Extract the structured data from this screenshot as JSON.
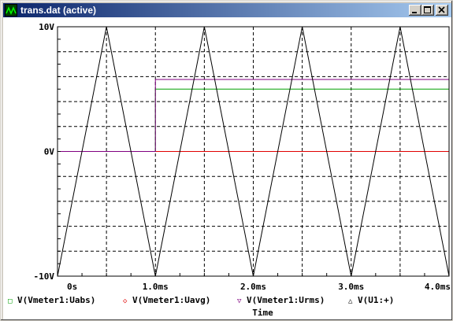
{
  "window": {
    "title": "trans.dat (active)",
    "controls": [
      "minimize",
      "maximize",
      "close"
    ]
  },
  "plot": {
    "background": "#ffffff",
    "grid_color": "#000000",
    "y_tick_labels": [
      "10V",
      "0V",
      "-10V"
    ],
    "x_tick_labels": [
      "0s",
      "1.0ms",
      "2.0ms",
      "3.0ms",
      "4.0ms"
    ],
    "xlabel": "Time",
    "legend": [
      {
        "symbol": "□",
        "label": "V(Vmeter1:Uabs)",
        "color": "#00a000"
      },
      {
        "symbol": "◇",
        "label": "V(Vmeter1:Uavg)",
        "color": "#e00000"
      },
      {
        "symbol": "▽",
        "label": "V(Vmeter1:Urms)",
        "color": "#800080"
      },
      {
        "symbol": "△",
        "label": "V(U1:+)",
        "color": "#000000"
      }
    ]
  },
  "chart_data": {
    "type": "line",
    "x_unit": "ms",
    "y_unit": "V",
    "xlim": [
      0,
      4
    ],
    "ylim": [
      -10,
      10
    ],
    "grid": true,
    "legend_position": "bottom",
    "series": [
      {
        "name": "V(Vmeter1:Uabs)",
        "color": "#00a000",
        "points": [
          [
            0,
            0
          ],
          [
            1.0,
            0
          ],
          [
            1.0,
            5
          ],
          [
            4.0,
            5
          ]
        ]
      },
      {
        "name": "V(Vmeter1:Uavg)",
        "color": "#e00000",
        "points": [
          [
            0,
            0
          ],
          [
            4.0,
            0
          ]
        ]
      },
      {
        "name": "V(Vmeter1:Urms)",
        "color": "#800080",
        "points": [
          [
            0,
            0
          ],
          [
            1.0,
            0
          ],
          [
            1.0,
            5.77
          ],
          [
            4.0,
            5.77
          ]
        ]
      },
      {
        "name": "V(U1:+)",
        "color": "#000000",
        "points": [
          [
            0,
            -10
          ],
          [
            0.5,
            10
          ],
          [
            1.0,
            -10
          ],
          [
            1.5,
            10
          ],
          [
            2.0,
            -10
          ],
          [
            2.5,
            10
          ],
          [
            3.0,
            -10
          ],
          [
            3.5,
            10
          ],
          [
            4.0,
            -10
          ]
        ]
      }
    ]
  }
}
